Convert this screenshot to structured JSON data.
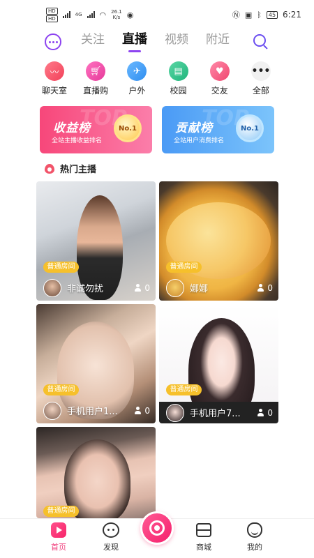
{
  "status_bar": {
    "left_badge_top": "HD",
    "left_badge_bottom": "HD",
    "net_4g": "4G",
    "net_speed_value": "26.1",
    "net_speed_unit": "K/s",
    "battery": "45",
    "time": "6:21"
  },
  "top_nav": {
    "tabs": [
      {
        "label": "关注",
        "active": false
      },
      {
        "label": "直播",
        "active": true
      },
      {
        "label": "视频",
        "active": false
      },
      {
        "label": "附近",
        "active": false
      }
    ],
    "accent": "#8d44f0"
  },
  "categories": [
    {
      "label": "聊天室",
      "icon": "voice-wave-icon",
      "color": "#f5556b"
    },
    {
      "label": "直播购",
      "icon": "shopping-cart-icon",
      "color": "#f447a3"
    },
    {
      "label": "户外",
      "icon": "airplane-icon",
      "color": "#3a9df5"
    },
    {
      "label": "校园",
      "icon": "book-icon",
      "color": "#2cc28a"
    },
    {
      "label": "交友",
      "icon": "heart-icon",
      "color": "#f75a86"
    },
    {
      "label": "全部",
      "icon": "more-dots-icon",
      "color": "#eeeeee"
    }
  ],
  "banners": {
    "income": {
      "title": "收益榜",
      "subtitle": "全站主播收益排名",
      "medal": "No.1",
      "bg_text": "TOP"
    },
    "contrib": {
      "title": "贡献榜",
      "subtitle": "全站用户消费排名",
      "medal": "No.1",
      "bg_text": "TOP"
    }
  },
  "section": {
    "title": "热门主播"
  },
  "streams": [
    {
      "tag": "普通房间",
      "name": "非诚勿扰",
      "viewers": "0"
    },
    {
      "tag": "普通房间",
      "name": "娜娜",
      "viewers": "0"
    },
    {
      "tag": "普通房间",
      "name": "手机用户1...",
      "viewers": "0"
    },
    {
      "tag": "普通房间",
      "name": "手机用户7...",
      "viewers": "0"
    },
    {
      "tag": "普通房间"
    }
  ],
  "bottom_nav": {
    "items": [
      {
        "label": "首页",
        "active": true
      },
      {
        "label": "发现",
        "active": false
      },
      {
        "label": "商城",
        "active": false
      },
      {
        "label": "我的",
        "active": false
      }
    ],
    "active_color": "#f0417e"
  }
}
